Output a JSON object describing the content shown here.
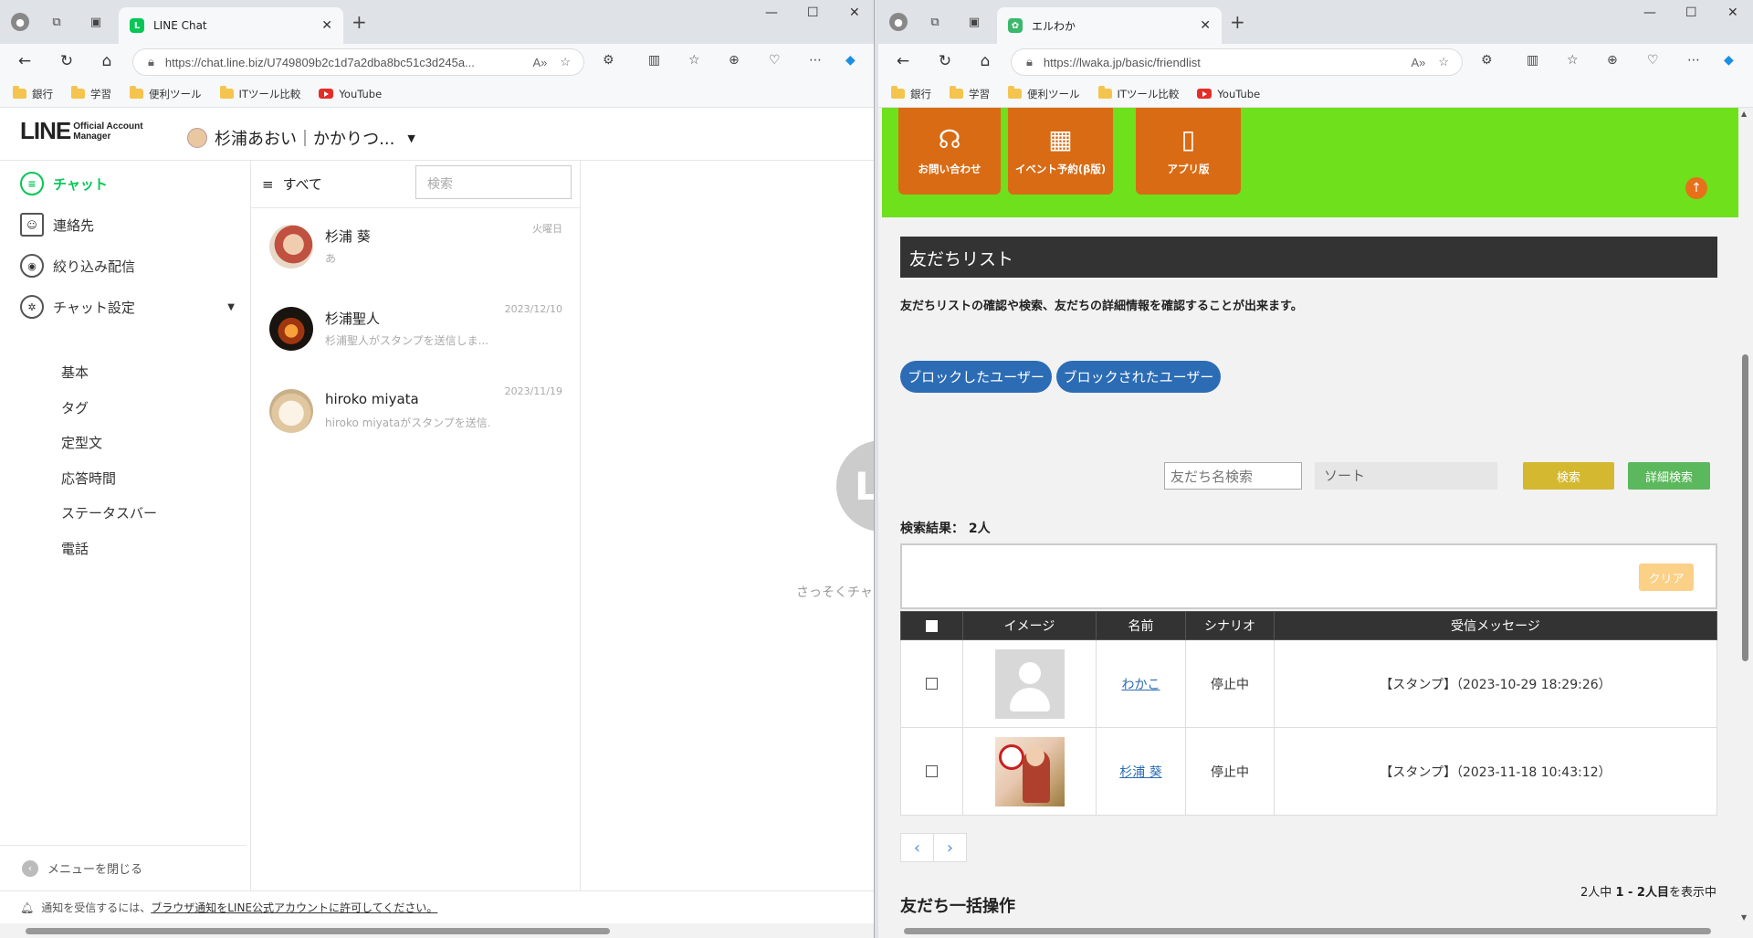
{
  "left_browser": {
    "tab_title": "LINE Chat",
    "url": "https://chat.line.biz/U749809b2c1d7a2dba8bc51c3d245a...",
    "bookmarks": [
      "銀行",
      "学習",
      "便利ツール",
      "ITツール比較",
      "YouTube"
    ]
  },
  "line": {
    "logo_big": "LINE",
    "logo_small_1": "Official Account",
    "logo_small_2": "Manager",
    "account_name": "杉浦あおい｜かかりつ...",
    "sidebar": {
      "chat": "チャット",
      "contacts": "連絡先",
      "filtered": "絞り込み配信",
      "settings": "チャット設定",
      "sub": [
        "基本",
        "タグ",
        "定型文",
        "応答時間",
        "ステータスバー",
        "電話"
      ],
      "close_menu": "メニューを閉じる"
    },
    "filter_label": "すべて",
    "search_placeholder": "検索",
    "chats": [
      {
        "name": "杉浦 葵",
        "preview": "あ",
        "date": "火曜日"
      },
      {
        "name": "杉浦聖人",
        "preview": "杉浦聖人がスタンプを送信しま...",
        "date": "2023/12/10"
      },
      {
        "name": "hiroko miyata",
        "preview": "hiroko miyataがスタンプを送信...",
        "date": "2023/11/19"
      }
    ],
    "empty_text": "さっそくチャ",
    "empty_logo": "L",
    "notify_text": "通知を受信するには、",
    "notify_link": "ブラウザ通知をLINE公式アカウントに許可してください。"
  },
  "right_browser": {
    "tab_title": "エルわか",
    "url": "https://lwaka.jp/basic/friendlist",
    "bookmarks": [
      "銀行",
      "学習",
      "便利ツール",
      "ITツール比較",
      "YouTube"
    ]
  },
  "lwaka": {
    "nav_buttons": [
      "お問い合わせ",
      "イベント予約(β版)",
      "アプリ版"
    ],
    "page_title": "友だちリスト",
    "description": "友だちリストの確認や検索、友だちの詳細情報を確認することが出来ます。",
    "blocked_btn": "ブロックしたユーザー",
    "blocked_by_btn": "ブロックされたユーザー",
    "name_search_placeholder": "友だち名検索",
    "sort_label": "ソート",
    "search_btn": "検索",
    "detail_search_btn": "詳細検索",
    "result_label": "検索結果：",
    "result_count": "2人",
    "clear_btn": "クリア",
    "table_headers": [
      "イメージ",
      "名前",
      "シナリオ",
      "受信メッセージ"
    ],
    "rows": [
      {
        "name": "わかこ",
        "scenario": "停止中",
        "message": "【スタンプ】（2023-10-29 18:29:26）"
      },
      {
        "name": "杉浦 葵",
        "scenario": "停止中",
        "message": "【スタンプ】（2023-11-18 10:43:12）"
      }
    ],
    "pager_prev": "‹",
    "pager_next": "›",
    "page_info_prefix": "2人中",
    "page_info_range": "1 - 2人目",
    "page_info_suffix": "を表示中",
    "bulk_title": "友だち一括操作"
  },
  "colors": {
    "line_green": "#06c755",
    "lwaka_green_bar": "#6ee01c",
    "lwaka_orange": "#d96b14",
    "pill_blue": "#2b6cb5",
    "search_yellow": "#d4b830",
    "detail_green": "#5cb85c"
  }
}
